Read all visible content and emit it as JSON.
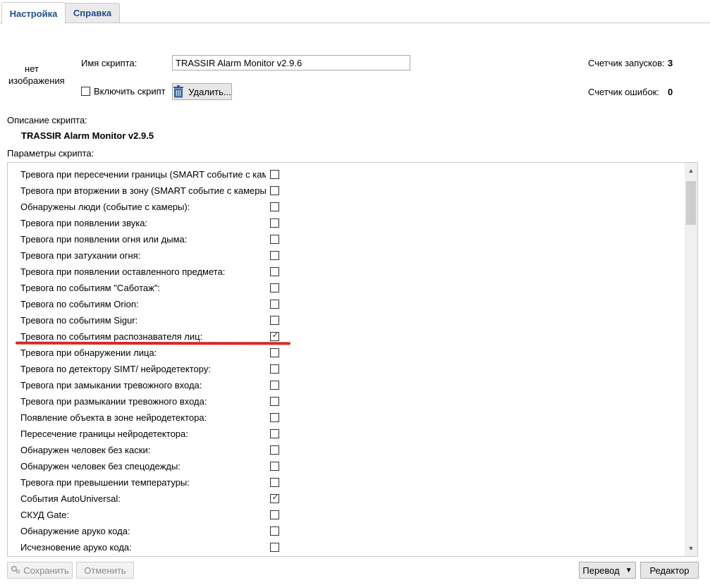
{
  "tabs": [
    {
      "label": "Настройка",
      "active": true
    },
    {
      "label": "Справка",
      "active": false
    }
  ],
  "no_image_text": "нет изображения",
  "script_name_label": "Имя скрипта:",
  "script_name_value": "TRASSIR Alarm Monitor v2.9.6",
  "enable_script_label": "Включить скрипт",
  "enable_script_checked": false,
  "delete_button": "Удалить...",
  "launch_counter_label": "Счетчик запусков:",
  "launch_counter_value": "3",
  "error_counter_label": "Счетчик ошибок:",
  "error_counter_value": "0",
  "description_label": "Описание скрипта:",
  "description_value": "TRASSIR Alarm Monitor v2.9.5",
  "params_label": "Параметры скрипта:",
  "params": [
    {
      "label": "Тревога при пересечении границы (SMART событие с камеры)",
      "checked": false
    },
    {
      "label": "Тревога при вторжении в зону (SMART событие с камеры)",
      "checked": false
    },
    {
      "label": "Обнаружены люди (событие с камеры):",
      "checked": false
    },
    {
      "label": "Тревога при появлении звука:",
      "checked": false
    },
    {
      "label": "Тревога при появлении огня или дыма:",
      "checked": false
    },
    {
      "label": "Тревога при затухании огня:",
      "checked": false
    },
    {
      "label": "Тревога при появлении оставленного предмета:",
      "checked": false
    },
    {
      "label": "Тревога по событиям \"Саботаж\":",
      "checked": false
    },
    {
      "label": "Тревога по событиям Orion:",
      "checked": false
    },
    {
      "label": "Тревога по событиям Sigur:",
      "checked": false
    },
    {
      "label": "Тревога по событиям распознавателя лиц:",
      "checked": true
    },
    {
      "label": "Тревога при обнаружении лица:",
      "checked": false
    },
    {
      "label": "Тревога по детектору SIMT/ нейродетектору:",
      "checked": false
    },
    {
      "label": "Тревога при замыкании тревожного входа:",
      "checked": false
    },
    {
      "label": "Тревога при размыкании тревожного входа:",
      "checked": false
    },
    {
      "label": "Появление объекта в зоне нейродетектора:",
      "checked": false
    },
    {
      "label": "Пересечение границы нейродетектора:",
      "checked": false
    },
    {
      "label": "Обнаружен человек без каски:",
      "checked": false
    },
    {
      "label": "Обнаружен человек без спецодежды:",
      "checked": false
    },
    {
      "label": "Тревога при превышении температуры:",
      "checked": false
    },
    {
      "label": "События AutoUniversal:",
      "checked": true
    },
    {
      "label": "СКУД Gate:",
      "checked": false
    },
    {
      "label": "Обнаружение аруко кода:",
      "checked": false
    },
    {
      "label": "Исчезновение аруко кода:",
      "checked": false
    }
  ],
  "footer": {
    "save": "Сохранить",
    "cancel": "Отменить",
    "translate": "Перевод",
    "editor": "Редактор"
  },
  "highlight_color": "#d42a2a",
  "icons": {
    "delete": "trash-icon",
    "save": "gear-icon",
    "translate": "dropdown-arrow-icon"
  }
}
